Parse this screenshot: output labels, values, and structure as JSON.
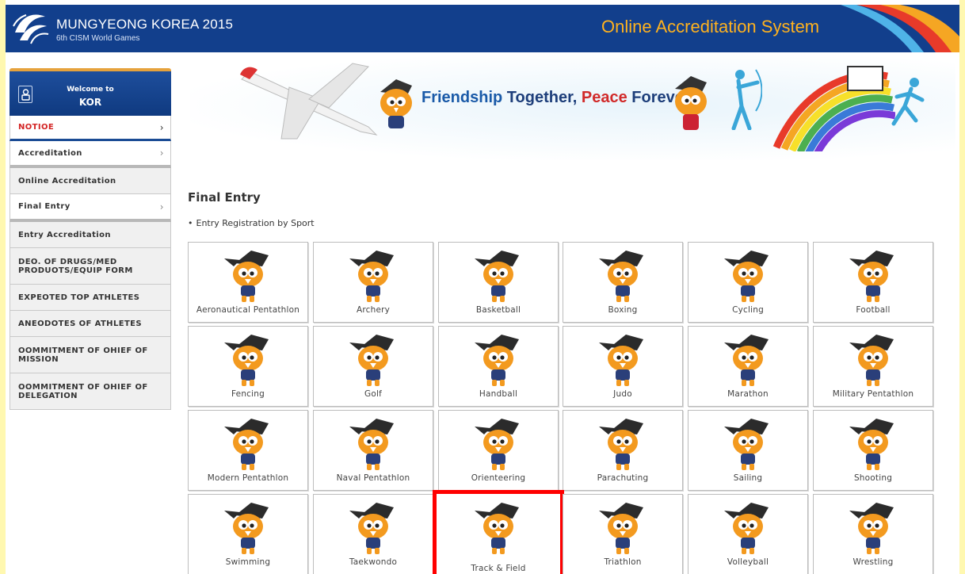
{
  "header": {
    "brand_title": "MUNGYEONG KOREA 2015",
    "brand_sub": "6th CISM World Games",
    "system_title": "Online Accreditation System"
  },
  "banner": {
    "w1": "Friendship",
    "w2": "Together,",
    "w3": "Peace",
    "w4": "Forever"
  },
  "sidebar": {
    "welcome_line": "Welcome to",
    "country": "KOR",
    "items": [
      {
        "label": "NOTIOE"
      },
      {
        "label": "Accreditation"
      },
      {
        "label": "Online Accreditation"
      },
      {
        "label": "Final Entry"
      },
      {
        "label": "Entry Accreditation"
      },
      {
        "label": "DEO. OF DRUGS/MED PRODUOTS/EQUIP FORM"
      },
      {
        "label": "EXPEOTED TOP ATHLETES"
      },
      {
        "label": "ANEODOTES OF ATHLETES"
      },
      {
        "label": "OOMMITMENT OF OHIEF OF MISSION"
      },
      {
        "label": "OOMMITMENT OF OHIEF OF DELEGATION"
      }
    ]
  },
  "main": {
    "title": "Final Entry",
    "subtitle": "Entry Registration by Sport",
    "sports": [
      {
        "label": "Aeronautical Pentathlon"
      },
      {
        "label": "Archery"
      },
      {
        "label": "Basketball"
      },
      {
        "label": "Boxing"
      },
      {
        "label": "Cycling"
      },
      {
        "label": "Football"
      },
      {
        "label": "Fencing"
      },
      {
        "label": "Golf"
      },
      {
        "label": "Handball"
      },
      {
        "label": "Judo"
      },
      {
        "label": "Marathon"
      },
      {
        "label": "Military Pentathlon"
      },
      {
        "label": "Modern Pentathlon"
      },
      {
        "label": "Naval Pentathlon"
      },
      {
        "label": "Orienteering"
      },
      {
        "label": "Parachuting"
      },
      {
        "label": "Sailing"
      },
      {
        "label": "Shooting"
      },
      {
        "label": "Swimming"
      },
      {
        "label": "Taekwondo"
      },
      {
        "label": "Track & Field"
      },
      {
        "label": "Triathlon"
      },
      {
        "label": "Volleyball"
      },
      {
        "label": "Wrestling"
      }
    ]
  },
  "colors": {
    "header_bg": "#123f8c",
    "accent_orange": "#ffb21e",
    "highlight_red": "#ff0000",
    "notice_red": "#d32323"
  }
}
